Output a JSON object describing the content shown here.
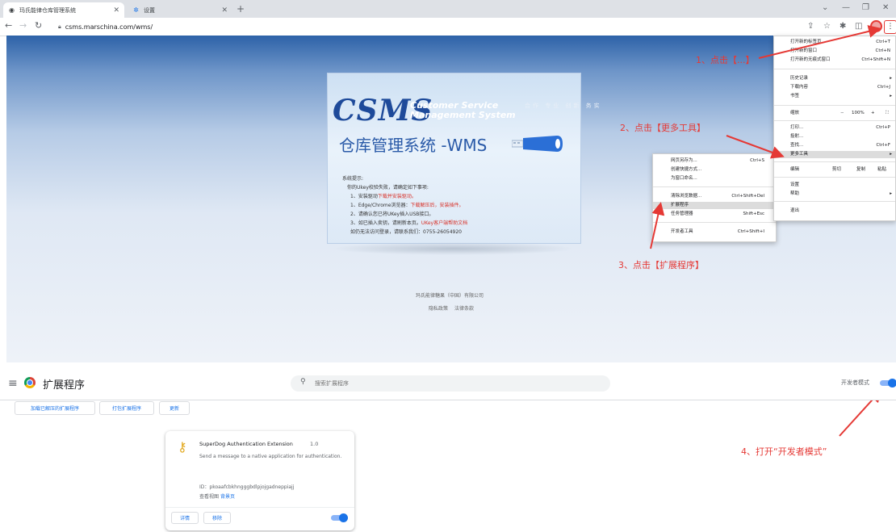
{
  "browser": {
    "tabs": [
      {
        "title": "玛氏能律仓库管理系统",
        "active": true
      },
      {
        "title": "设置",
        "active": false
      }
    ],
    "url": "csms.marschina.com/wms/"
  },
  "login_page": {
    "logo_text": "CSMS",
    "logo_sub1": "Customer Service",
    "logo_sub2": "Management System",
    "logo_deco": "合作 专业 创新 务实",
    "title": "仓库管理系统 -WMS",
    "tips_title": "系统提示:",
    "tips": [
      {
        "text": "你的Ukey校验失败，请确定如下事项:",
        "highlight": ""
      },
      {
        "text": "1、安装驱动",
        "highlight": "下载并安装驱动。"
      },
      {
        "text": "1、Edge/Chrome浏览器：",
        "highlight": "下载解压后，安装插件。"
      },
      {
        "text": "2、请确认您已将UKey插入USB接口。",
        "highlight": ""
      },
      {
        "text": "3、如已插入卖钥，请刷新本页。",
        "highlight": "UKey客户端帮助文档"
      },
      {
        "text": "如仍无法访问登录，请联系我们：0755-26054920",
        "highlight": ""
      }
    ],
    "footer_company": "玛氏能律糖果（中国）有限公司",
    "footer_links": [
      "隐私政策",
      "法律条款"
    ]
  },
  "chrome_menu": {
    "items": [
      {
        "label": "打开新的标签页",
        "shortcut": "Ctrl+T"
      },
      {
        "label": "打开新的窗口",
        "shortcut": "Ctrl+N"
      },
      {
        "label": "打开新的无痕式窗口",
        "shortcut": "Ctrl+Shift+N"
      },
      {
        "label": "历史记录",
        "shortcut": "▸"
      },
      {
        "label": "下载内容",
        "shortcut": "Ctrl+J"
      },
      {
        "label": "书签",
        "shortcut": "▸"
      },
      {
        "label": "缩放",
        "shortcut": ""
      },
      {
        "label": "打印...",
        "shortcut": "Ctrl+P"
      },
      {
        "label": "投射...",
        "shortcut": ""
      },
      {
        "label": "查找...",
        "shortcut": "Ctrl+F"
      },
      {
        "label": "更多工具",
        "shortcut": "▸"
      },
      {
        "label": "编辑",
        "shortcut": ""
      },
      {
        "label": "设置",
        "shortcut": ""
      },
      {
        "label": "帮助",
        "shortcut": "▸"
      },
      {
        "label": "退出",
        "shortcut": ""
      }
    ],
    "zoom": {
      "minus": "−",
      "value": "100%",
      "plus": "+",
      "fullscreen": "⛶"
    },
    "edit": {
      "cut": "剪切",
      "copy": "复制",
      "paste": "粘贴"
    }
  },
  "more_tools_menu": {
    "items": [
      {
        "label": "网页另存为...",
        "shortcut": "Ctrl+S"
      },
      {
        "label": "创建快捷方式...",
        "shortcut": ""
      },
      {
        "label": "为窗口命名...",
        "shortcut": ""
      },
      {
        "label": "清除浏览数据...",
        "shortcut": "Ctrl+Shift+Del"
      },
      {
        "label": "扩展程序",
        "shortcut": ""
      },
      {
        "label": "任务管理器",
        "shortcut": "Shift+Esc"
      },
      {
        "label": "开发者工具",
        "shortcut": "Ctrl+Shift+I"
      }
    ]
  },
  "annotations": {
    "step1": "1、点击【...】",
    "step2": "2、点击【更多工具】",
    "step3": "3、点击【扩展程序】",
    "step4": "4、打开“开发者模式”"
  },
  "extensions_page": {
    "title": "扩展程序",
    "search_placeholder": "搜索扩展程序",
    "dev_mode_label": "开发者模式",
    "dev_mode_on": true,
    "buttons": {
      "load_unpacked": "加载已解压的扩展程序",
      "pack": "打包扩展程序",
      "update": "更新"
    },
    "extension": {
      "name": "SuperDog Authentication Extension",
      "version": "1.0",
      "description": "Send a message to a native application for authentication.",
      "id": "ID：pkoaafcbkhngggbdlpjojgadneppiajj",
      "views_label": "查看视图",
      "views_link": "背景页",
      "details": "详情",
      "remove": "移除",
      "enabled": true
    }
  },
  "colors": {
    "annotation": "#e53935",
    "accent": "#1a73e8"
  }
}
